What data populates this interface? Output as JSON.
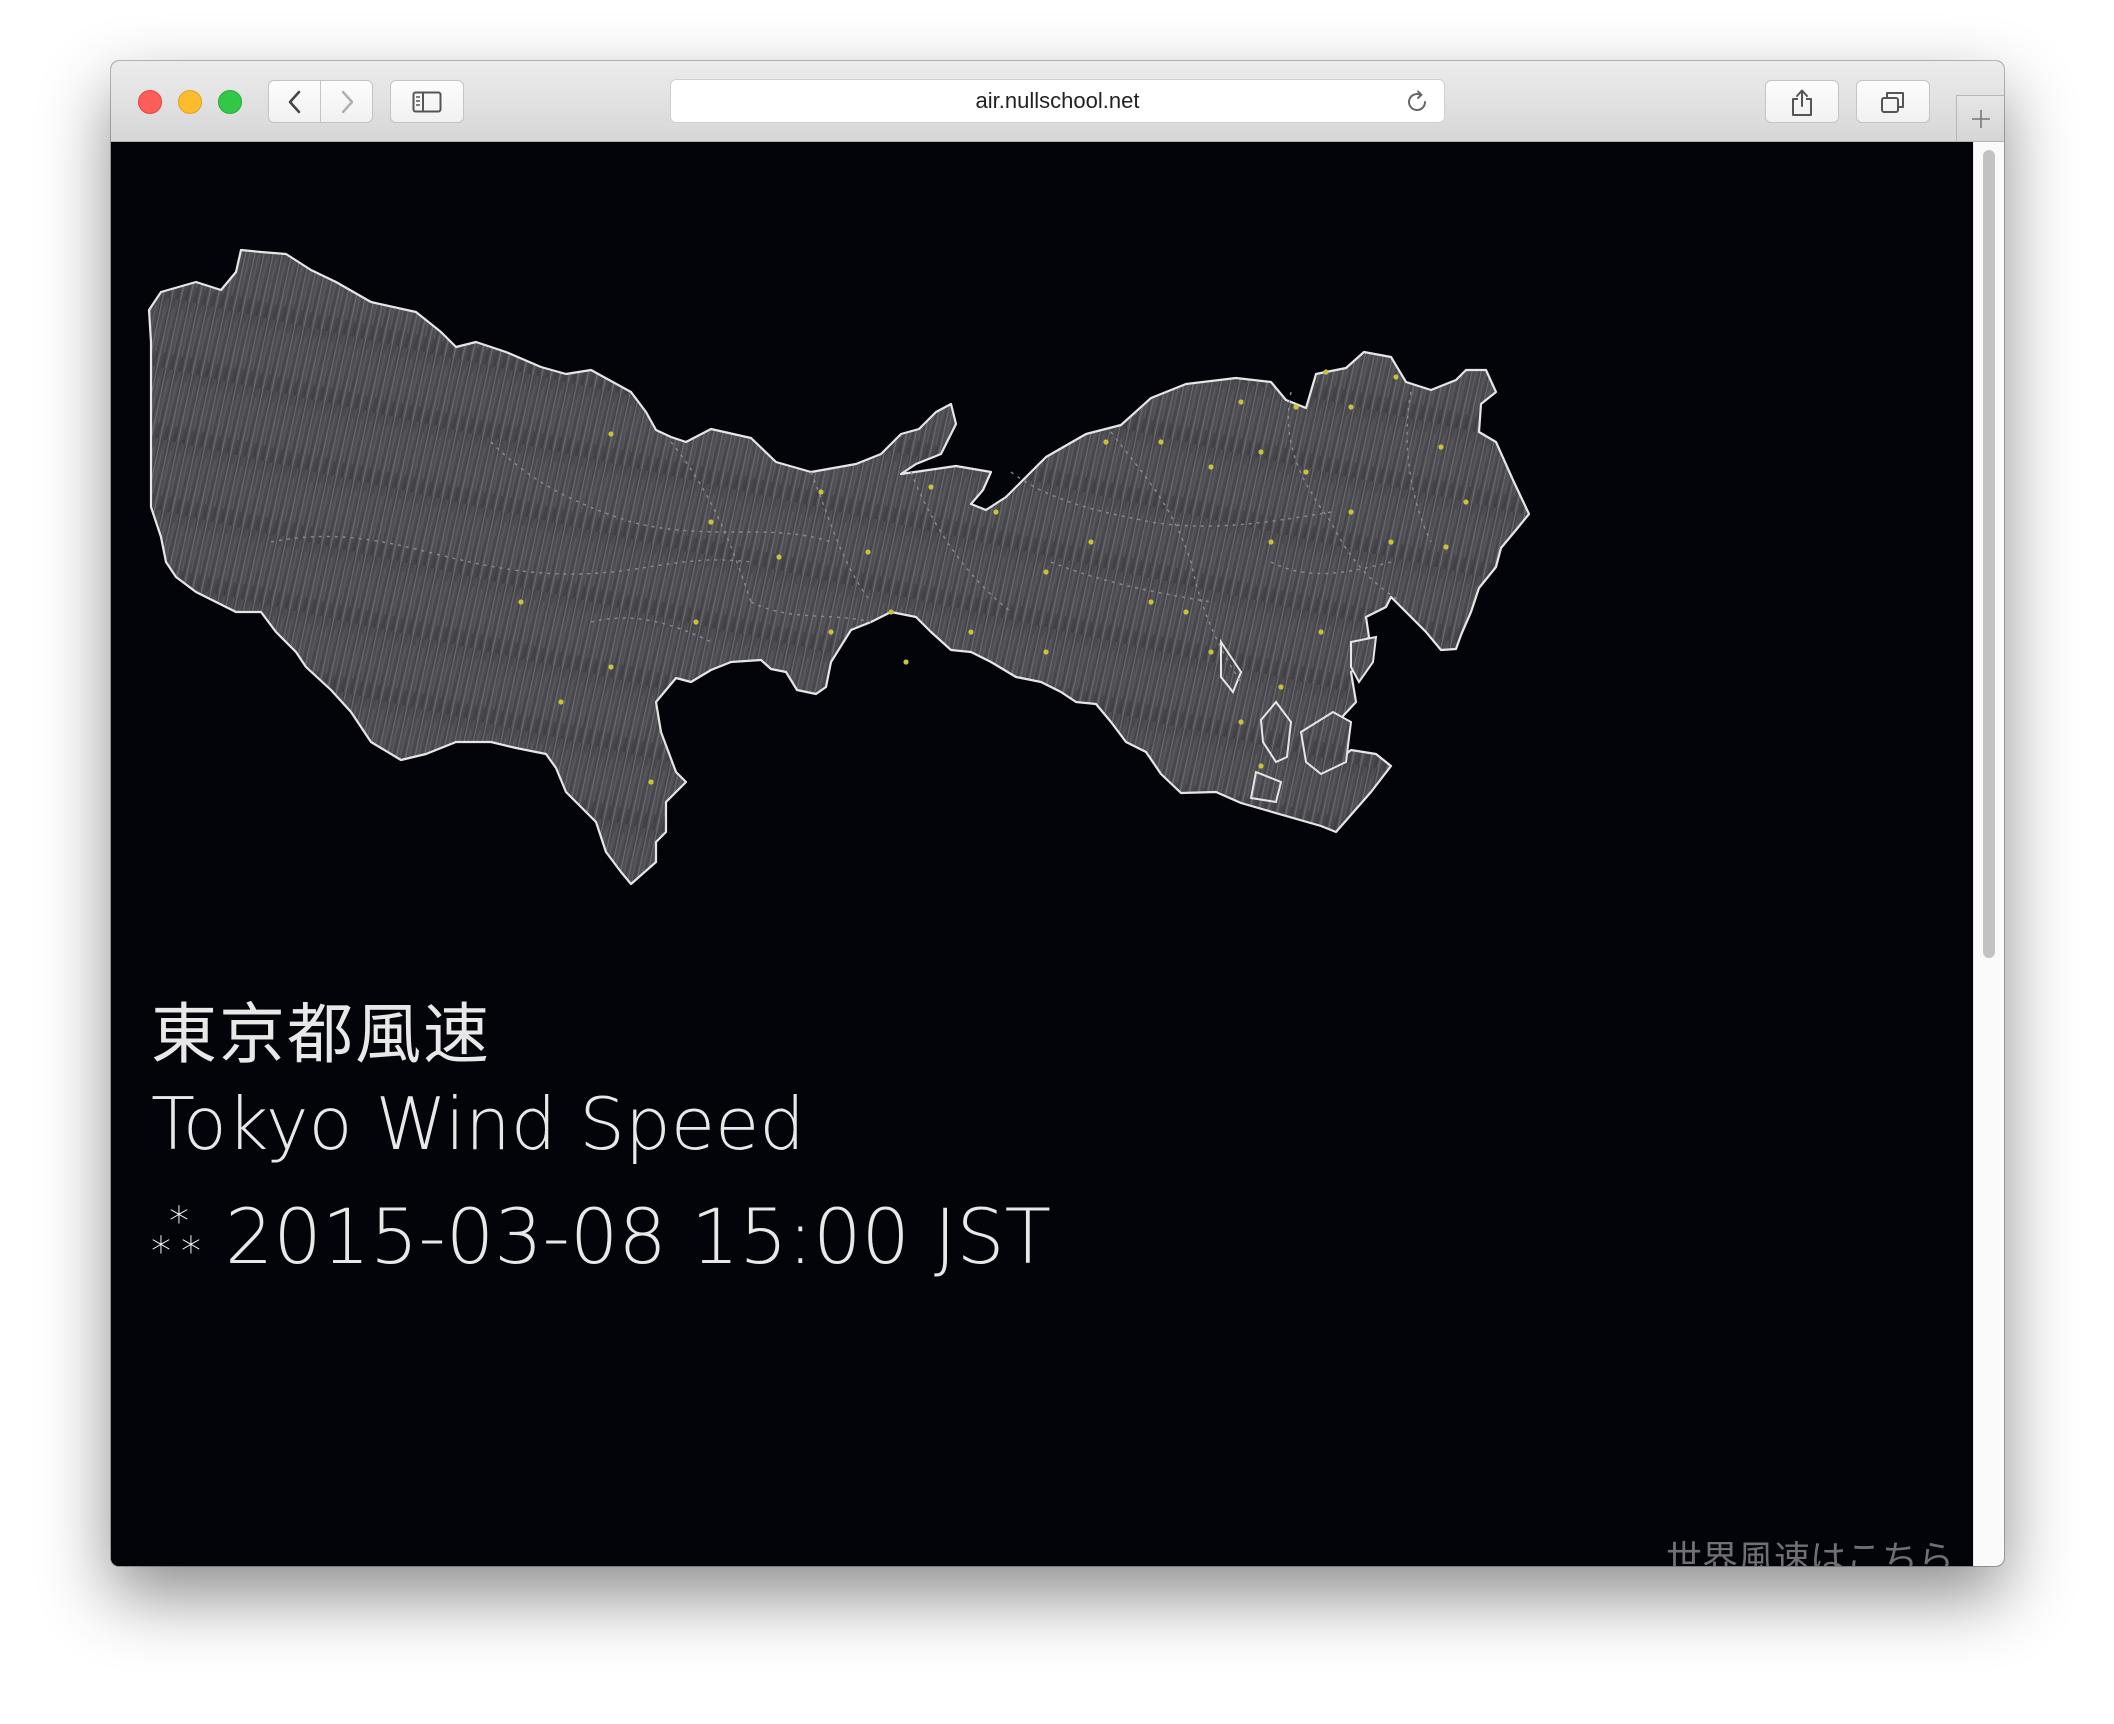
{
  "browser": {
    "url": "air.nullschool.net",
    "icons": {
      "back": "chevron-left-icon",
      "forward": "chevron-right-icon",
      "sidebar": "sidebar-icon",
      "reload": "reload-icon",
      "share": "share-icon",
      "tabs": "tabs-overview-icon",
      "new_tab": "plus-icon"
    }
  },
  "page": {
    "title_jp": "東京都風速",
    "title_en": "Tokyo Wind Speed",
    "datetime": "2015-03-08 15:00 JST",
    "datetime_icon": "stars-icon",
    "world_link_prefix": "世界風速は",
    "world_link_text": "こちら",
    "scroll_icon": "↓"
  },
  "colors": {
    "background": "#03030a",
    "map_fill": "#4a4a4e",
    "map_outline": "#e6e6e6",
    "station_dot": "#c9c23a",
    "text": "#e8e8e8",
    "link": "#6f6f74"
  }
}
